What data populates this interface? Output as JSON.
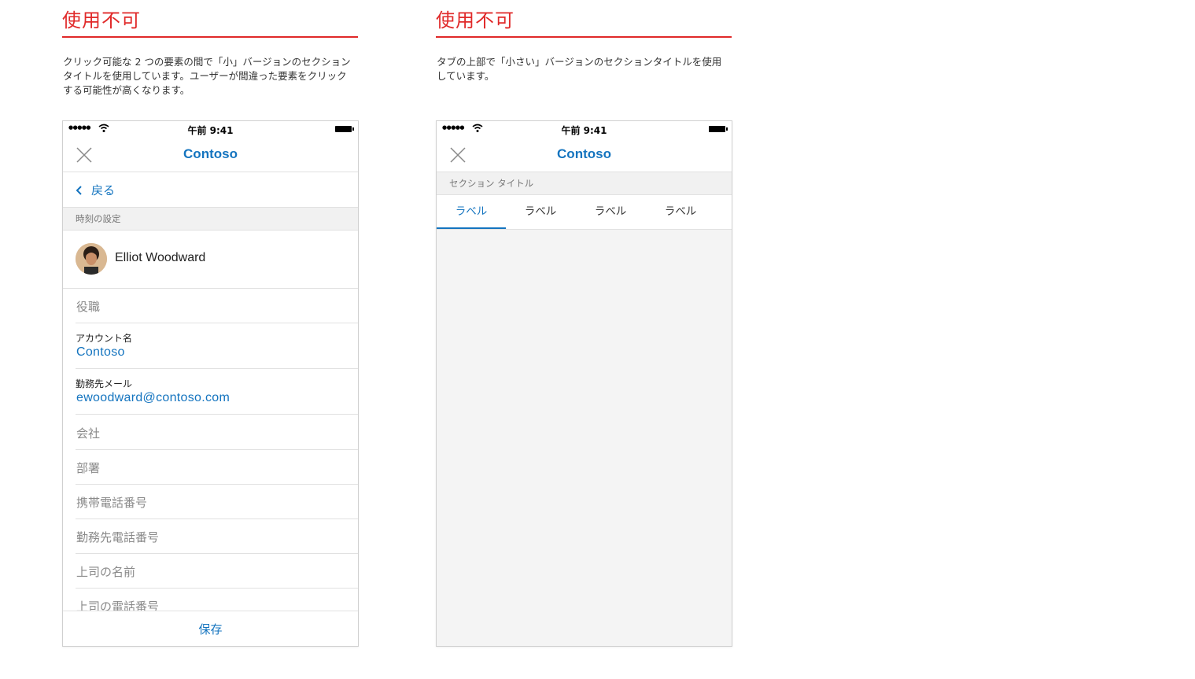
{
  "left": {
    "heading": "使用不可",
    "description": [
      "クリック可能な 2 つの要素の間で「小」バージョンのセクション",
      "タイトルを使用しています。ユーザーが間違った要素をクリック",
      "する可能性が高くなります。"
    ],
    "phone": {
      "status": {
        "time": "午前 9:41",
        "signal": "●●●●●"
      },
      "nav_title": "Contoso",
      "back_label": "戻る",
      "section_title": "時刻の設定",
      "person": {
        "name": "Elliot Woodward"
      },
      "fields": [
        {
          "placeholder": "役職"
        },
        {
          "label": "アカウント名",
          "value": "Contoso"
        },
        {
          "label": "勤務先メール",
          "value": "ewoodward@contoso.com"
        },
        {
          "placeholder": "会社"
        },
        {
          "placeholder": "部署"
        },
        {
          "placeholder": "携帯電話番号"
        },
        {
          "placeholder": "勤務先電話番号"
        },
        {
          "placeholder": "上司の名前"
        },
        {
          "placeholder": "上司の電話番号"
        }
      ],
      "save_label": "保存"
    }
  },
  "right": {
    "heading": "使用不可",
    "description": [
      "タブの上部で「小さい」バージョンのセクションタイトルを使用",
      "しています。"
    ],
    "phone": {
      "status": {
        "time": "午前 9:41",
        "signal": "●●●●●"
      },
      "nav_title": "Contoso",
      "section_title": "セクション タイトル",
      "tabs": [
        "ラベル",
        "ラベル",
        "ラベル",
        "ラベル"
      ],
      "active_tab": 0
    }
  },
  "colors": {
    "heading_red": "#e02929",
    "accent_blue": "#1474bf",
    "section_bg": "#f1f1f1",
    "divider": "#e1e1e1"
  },
  "icons": [
    "close-icon",
    "wifi-icon",
    "battery-icon",
    "chevron-left-icon"
  ]
}
